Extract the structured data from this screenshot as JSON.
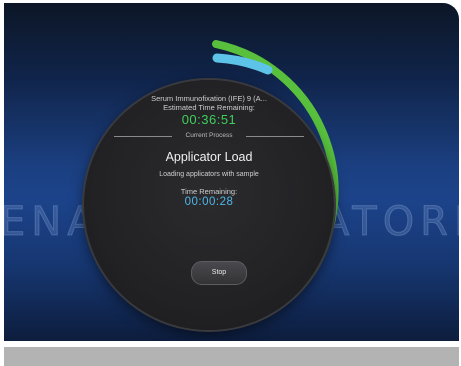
{
  "watermark": {
    "left": "ENA",
    "right": "ATORI"
  },
  "process": {
    "test_name": "Serum Immunofixation (IFE) 9 (A...",
    "estimated_label": "Estimated Time Remaining:",
    "estimated_time": "00:36:51",
    "current_process_label": "Current Process",
    "name": "Applicator Load",
    "description": "Loading applicators with sample",
    "time_remaining_label": "Time Remaining:",
    "time_remaining": "00:00:28"
  },
  "controls": {
    "stop_label": "Stop"
  },
  "progress": {
    "outer_arc_color": "#58c03d",
    "inner_arc_color": "#5ec3e8"
  }
}
